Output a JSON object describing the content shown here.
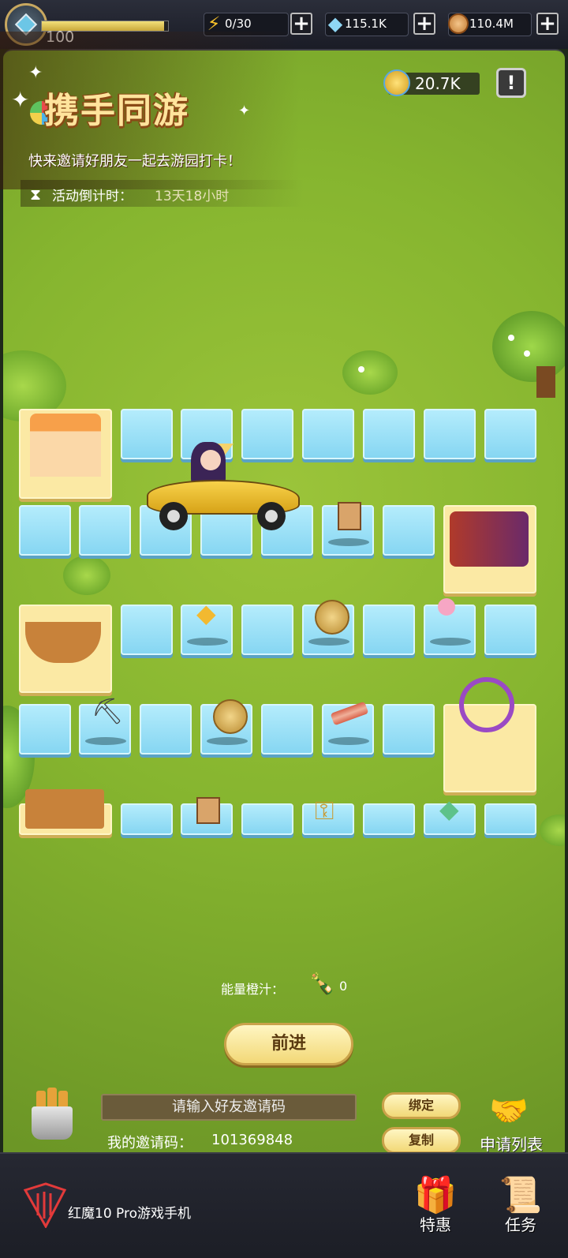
{
  "header": {
    "level": "100",
    "xp_fraction": 0.97,
    "energy": "0/30",
    "diamonds": "115.1K",
    "coins": "110.4M"
  },
  "event": {
    "title": "携手同游",
    "description": "快来邀请好朋友一起去游园打卡！",
    "countdown_label": "活动倒计时：",
    "countdown_value": "13天18小时",
    "event_currency": "20.7K",
    "info_icon": "!"
  },
  "controls": {
    "energy_juice_label": "能量橙汁：",
    "energy_juice_count": "0",
    "advance_button": "前进",
    "invite_placeholder": "请输入好友邀请码",
    "bind_button": "绑定",
    "my_code_label": "我的邀请码：",
    "my_code_value": "101369848",
    "copy_button": "复制",
    "request_list_label": "申请列表"
  },
  "footer": {
    "brand_text": "红魔10 Pro游戏手机",
    "nav": [
      {
        "label": "特惠",
        "icon": "gift-icon"
      },
      {
        "label": "任务",
        "icon": "scroll-icon"
      }
    ]
  },
  "board": {
    "rewards": [
      "dynamite",
      "amber-crystal",
      "gold-coin",
      "lollipop",
      "pickaxe",
      "gold-coin",
      "bacon",
      "dynamite",
      "key",
      "green-crystal"
    ],
    "stations": [
      "bakery-shop",
      "steam-train",
      "pirate-ship",
      "ferris-wheel",
      "observatory"
    ]
  },
  "colors": {
    "grass": "#86b52f",
    "tile": "#9fe2f8",
    "station": "#fbe9a4",
    "button_gold": "#f2d877"
  }
}
